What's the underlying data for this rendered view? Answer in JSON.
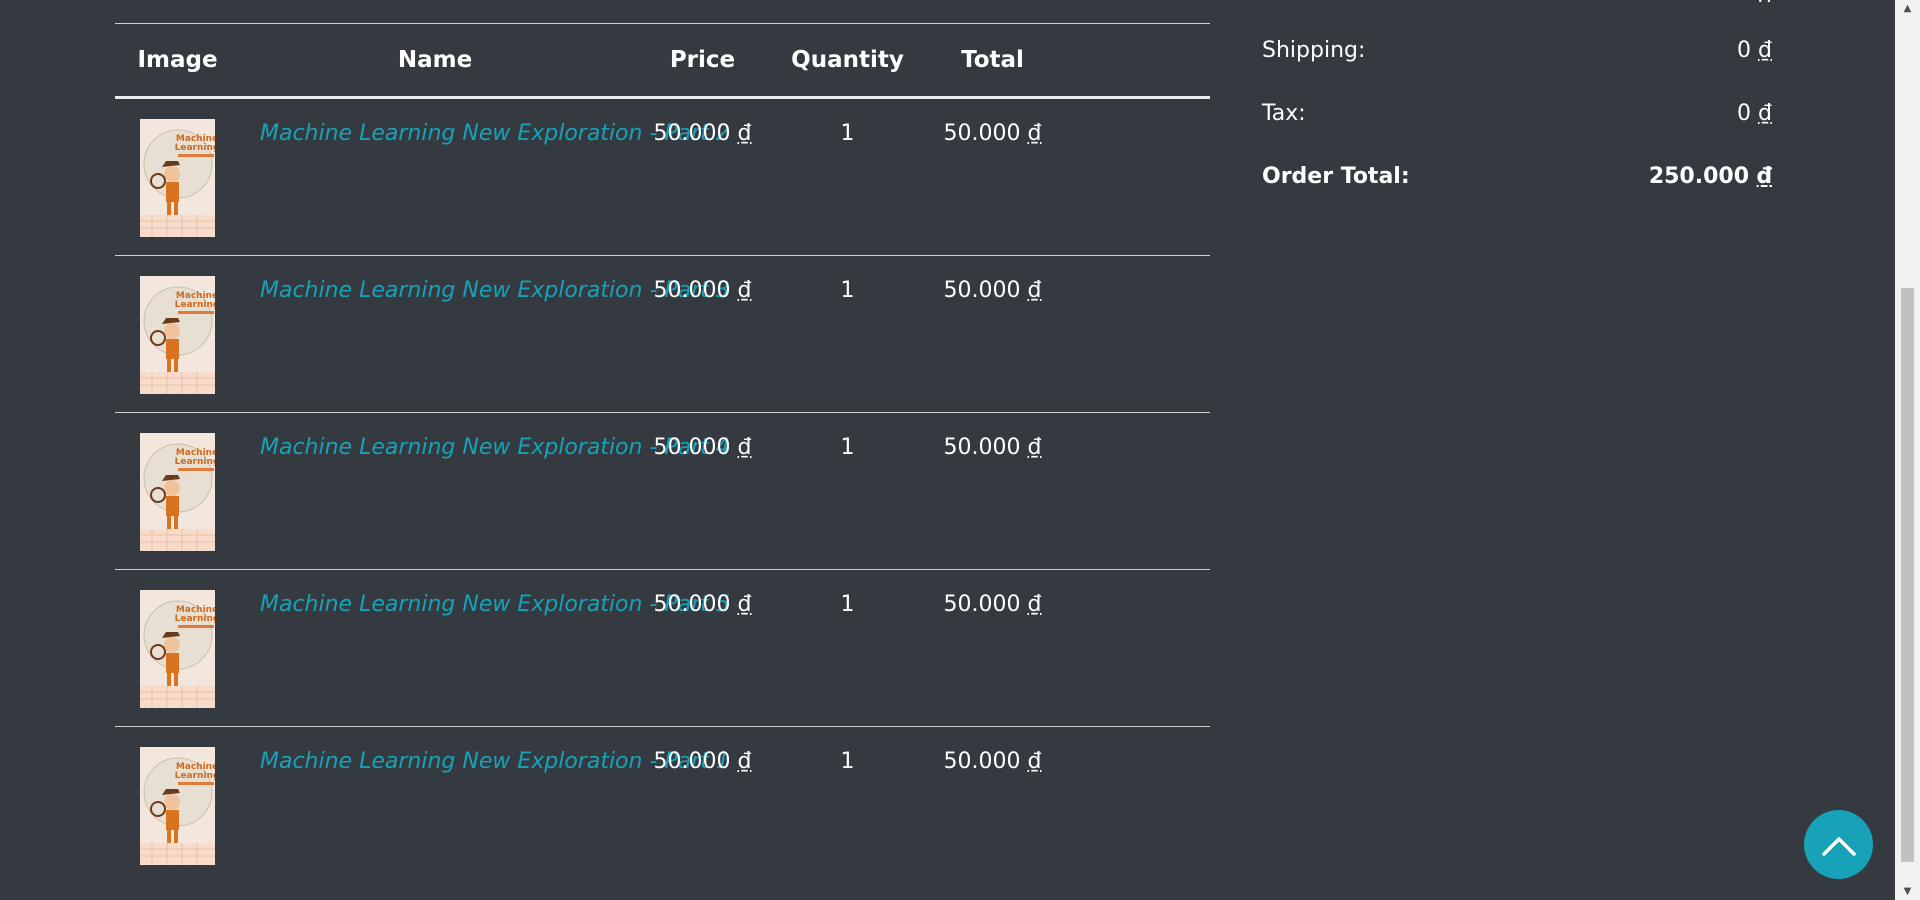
{
  "table": {
    "headers": {
      "image": "Image",
      "name": "Name",
      "price": "Price",
      "quantity": "Quantity",
      "total": "Total"
    },
    "rows": [
      {
        "name": "Machine Learning New Exploration - Part 2",
        "price": "50.000",
        "quantity": "1",
        "total": "50.000",
        "thumb_icon": "book-cover-thumbnail"
      },
      {
        "name": "Machine Learning New Exploration - Part 3",
        "price": "50.000",
        "quantity": "1",
        "total": "50.000",
        "thumb_icon": "book-cover-thumbnail"
      },
      {
        "name": "Machine Learning New Exploration - Part 4",
        "price": "50.000",
        "quantity": "1",
        "total": "50.000",
        "thumb_icon": "book-cover-thumbnail"
      },
      {
        "name": "Machine Learning New Exploration - Part 5",
        "price": "50.000",
        "quantity": "1",
        "total": "50.000",
        "thumb_icon": "book-cover-thumbnail"
      },
      {
        "name": "Machine Learning New Exploration - Part 1",
        "price": "50.000",
        "quantity": "1",
        "total": "50.000",
        "thumb_icon": "book-cover-thumbnail"
      }
    ],
    "currency_symbol": "₫"
  },
  "summary": {
    "shipping_label": "Shipping:",
    "shipping_value": "0",
    "tax_label": "Tax:",
    "tax_value": "0",
    "order_total_label": "Order Total:",
    "order_total_value": "250.000",
    "currency_symbol": "₫"
  },
  "back_to_top": {
    "icon": "chevron-up-icon"
  },
  "colors": {
    "background": "#343a40",
    "link": "#17a2b8",
    "accent_button": "#17a2b8",
    "text": "#ffffff"
  }
}
